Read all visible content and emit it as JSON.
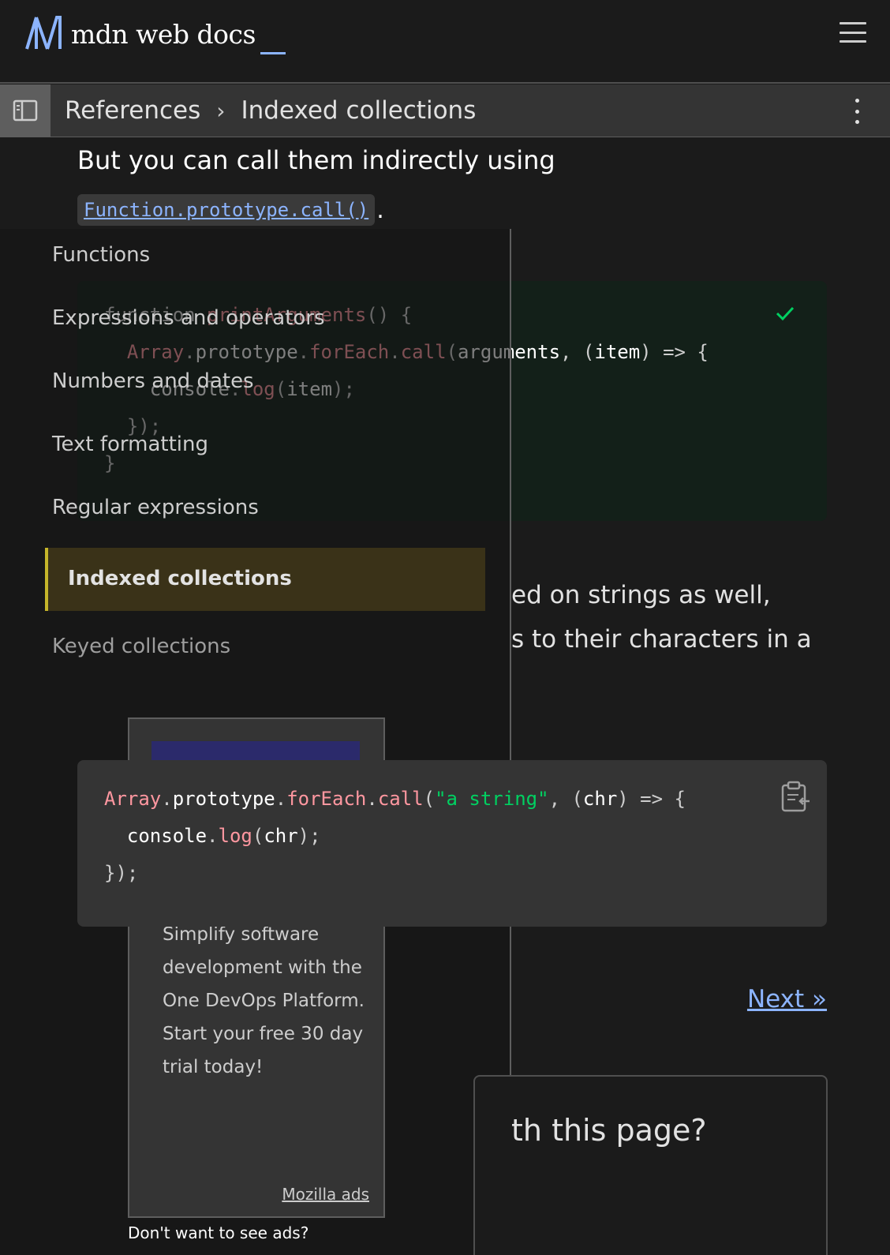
{
  "header": {
    "logo_text": "mdn web docs",
    "menu_icon": "hamburger-icon"
  },
  "breadcrumb": {
    "toggle_icon": "sidebar-toggle-icon",
    "items": [
      "References",
      "Indexed collections"
    ],
    "separator": "›",
    "more_icon": "kebab-icon"
  },
  "article": {
    "para1": "But you can call them indirectly using",
    "para1_link": "Function.prototype.call()",
    "para1_end": ".",
    "code1": {
      "lines": [
        "function printArguments() {",
        "  Array.prototype.forEach.call(arguments, (item) => {",
        "    console.log(item);",
        "  });",
        "}"
      ],
      "status_icon": "check-icon"
    },
    "para2_line1": "ed on strings as well,",
    "para2_line2": "s to their characters in a",
    "code2": {
      "lines": [
        "Array.prototype.forEach.call(\"a string\", (chr) => {",
        "  console.log(chr);",
        "});"
      ],
      "copy_icon": "clipboard-icon"
    },
    "next_link": "Next »",
    "feedback_title": "th this page?"
  },
  "sidebar": {
    "items": [
      "Functions",
      "Expressions and operators",
      "Numbers and dates",
      "Text formatting",
      "Regular expressions"
    ],
    "active": "Indexed collections",
    "after": [
      "Keyed collections"
    ]
  },
  "ad": {
    "text": "Simplify software development with the One DevOps Platform. Start your free 30 day trial today!",
    "label": "Mozilla ads",
    "no_ads": "Don't want to see ads?",
    "banner_color": "#2b2a6b"
  },
  "colors": {
    "accent_link": "#8cb4ff",
    "code_fn": "#ff97a0",
    "code_string": "#00d061",
    "active_marker": "#c6b62a"
  }
}
